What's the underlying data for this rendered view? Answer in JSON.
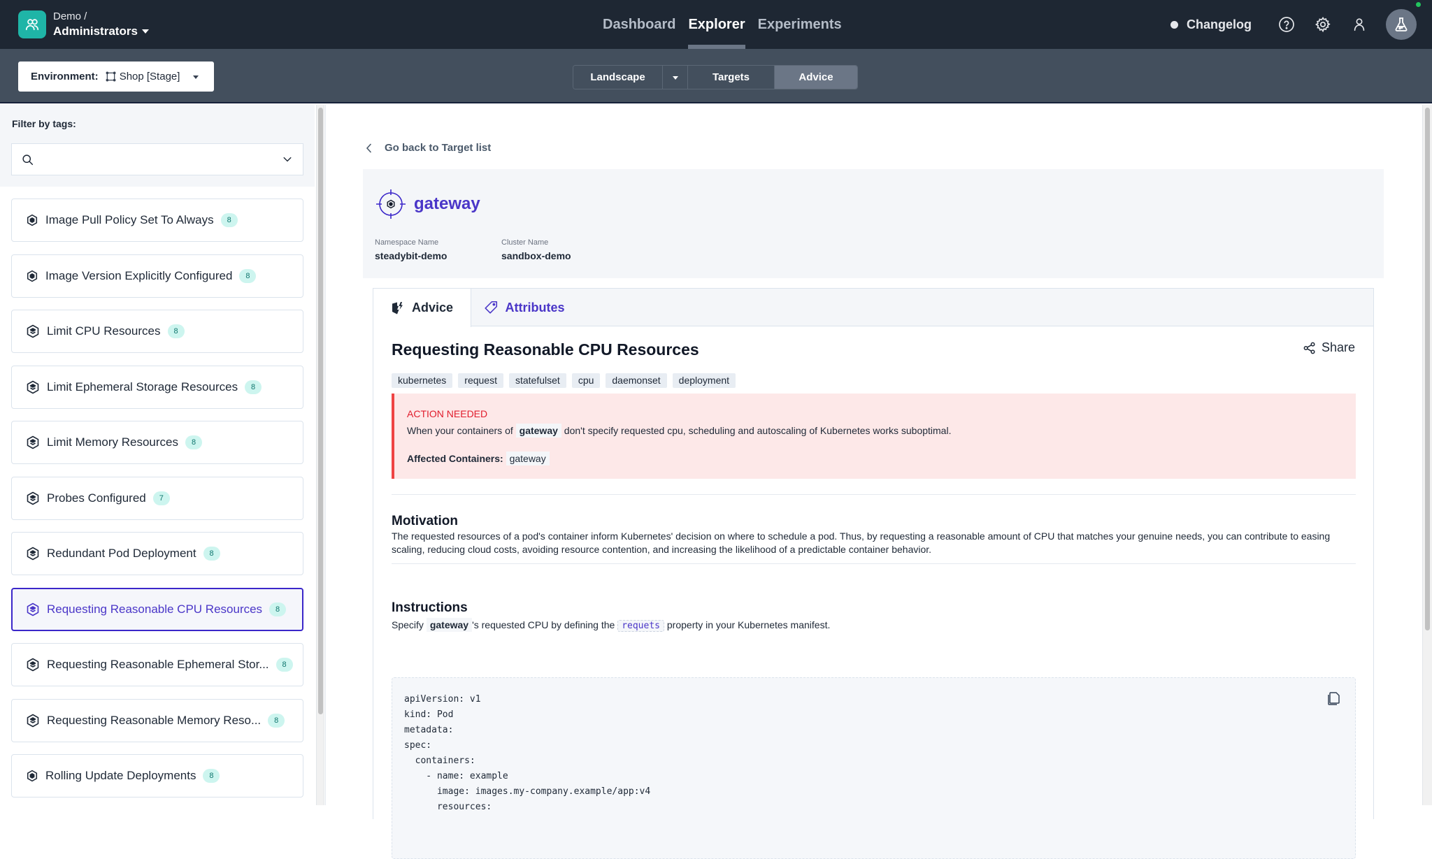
{
  "org": {
    "parent": "Demo /",
    "name": "Administrators",
    "icon": "users-icon"
  },
  "nav": {
    "items": [
      {
        "label": "Dashboard",
        "active": false
      },
      {
        "label": "Explorer",
        "active": true
      },
      {
        "label": "Experiments",
        "active": false
      }
    ],
    "changelog": "Changelog",
    "icons": [
      "help-circle-icon",
      "gear-icon",
      "user-icon",
      "flask-icon"
    ]
  },
  "subbar": {
    "environment_label": "Environment:",
    "environment_value": "Shop [Stage]",
    "segments": [
      {
        "label": "Landscape",
        "active": false
      },
      {
        "label": "Targets",
        "active": false
      },
      {
        "label": "Advice",
        "active": true
      }
    ]
  },
  "sidebar": {
    "filter_label": "Filter by tags:",
    "search_placeholder": "",
    "items": [
      {
        "label": "Image Pull Policy Set To Always",
        "count": "8",
        "icon": "hexagon-filled-icon",
        "active": false
      },
      {
        "label": "Image Version Explicitly Configured",
        "count": "8",
        "icon": "hexagon-filled-icon",
        "active": false
      },
      {
        "label": "Limit CPU Resources",
        "count": "8",
        "icon": "layers-hexagon-icon",
        "active": false
      },
      {
        "label": "Limit Ephemeral Storage Resources",
        "count": "8",
        "icon": "layers-hexagon-icon",
        "active": false
      },
      {
        "label": "Limit Memory Resources",
        "count": "8",
        "icon": "layers-hexagon-icon",
        "active": false
      },
      {
        "label": "Probes Configured",
        "count": "7",
        "icon": "layers-hexagon-icon",
        "active": false
      },
      {
        "label": "Redundant Pod Deployment",
        "count": "8",
        "icon": "layers-hexagon-icon",
        "active": false
      },
      {
        "label": "Requesting Reasonable CPU Resources",
        "count": "8",
        "icon": "layers-hexagon-icon",
        "active": true
      },
      {
        "label": "Requesting Reasonable Ephemeral Stor...",
        "count": "8",
        "icon": "layers-hexagon-icon",
        "active": false
      },
      {
        "label": "Requesting Reasonable Memory Reso...",
        "count": "8",
        "icon": "layers-hexagon-icon",
        "active": false
      },
      {
        "label": "Rolling Update Deployments",
        "count": "8",
        "icon": "hexagon-filled-icon",
        "active": false
      }
    ]
  },
  "main": {
    "back_label": "Go back to Target list",
    "target": {
      "name": "gateway",
      "attributes": [
        {
          "key": "Namespace Name",
          "value": "steadybit-demo"
        },
        {
          "key": "Cluster Name",
          "value": "sandbox-demo"
        }
      ]
    },
    "tabs": [
      {
        "label": "Advice",
        "active": true
      },
      {
        "label": "Attributes",
        "active": false
      }
    ],
    "advice": {
      "title": "Requesting Reasonable CPU Resources",
      "share_label": "Share",
      "tags": [
        "kubernetes",
        "request",
        "statefulset",
        "cpu",
        "daemonset",
        "deployment"
      ],
      "alert": {
        "title": "ACTION NEEDED",
        "msg_before": "When your containers of",
        "msg_highlight": "gateway",
        "msg_after": "don't specify requested cpu, scheduling and autoscaling of Kubernetes works suboptimal.",
        "affected_label": "Affected Containers:",
        "affected_value": "gateway"
      },
      "motivation": {
        "heading": "Motivation",
        "text": "The requested resources of a pod's container inform Kubernetes' decision on where to schedule a pod. Thus, by requesting a reasonable amount of CPU that matches your genuine needs, you can contribute to easing scaling, reducing cloud costs, avoiding resource contention, and increasing the likelihood of a predictable container behavior."
      },
      "instructions": {
        "heading": "Instructions",
        "prefix": "Specify",
        "target": "gateway",
        "middle": "'s requested CPU by defining the",
        "code": "requets",
        "suffix": "property in your Kubernetes manifest.",
        "codeblock": "apiVersion: v1\nkind: Pod\nmetadata:\nspec:\n  containers:\n    - name: example\n      image: images.my-company.example/app:v4\n      resources:"
      }
    }
  }
}
